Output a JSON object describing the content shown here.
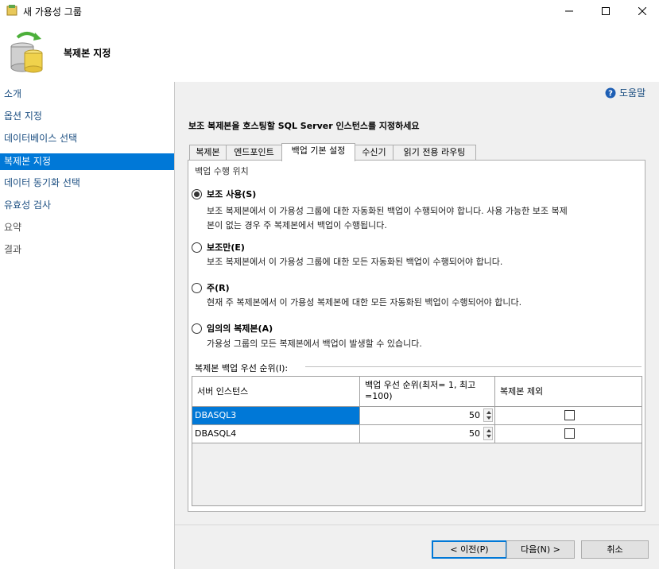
{
  "window": {
    "title": "새 가용성 그룹",
    "minimize_glyph": "—",
    "maximize_glyph": "☐",
    "close_glyph": "✕"
  },
  "header": {
    "title": "복제본 지정"
  },
  "nav": {
    "items": [
      {
        "label": "소개",
        "state": "link"
      },
      {
        "label": "옵션 지정",
        "state": "link"
      },
      {
        "label": "데이터베이스 선택",
        "state": "link"
      },
      {
        "label": "복제본 지정",
        "state": "active"
      },
      {
        "label": "데이터 동기화 선택",
        "state": "link"
      },
      {
        "label": "유효성 검사",
        "state": "link"
      },
      {
        "label": "요약",
        "state": "disabled"
      },
      {
        "label": "결과",
        "state": "disabled"
      }
    ]
  },
  "help": {
    "label": "도움말"
  },
  "main": {
    "instruction": "보조 복제본을 호스팅할 SQL Server 인스턴스를 지정하세요",
    "tabs": [
      {
        "label": "복제본"
      },
      {
        "label": "엔드포인트"
      },
      {
        "label": "백업 기본 설정",
        "active": true
      },
      {
        "label": "수신기"
      },
      {
        "label": "읽기 전용 라우팅"
      }
    ],
    "backup_location_label": "백업 수행 위치",
    "options": [
      {
        "label": "보조 사용(S)",
        "checked": true,
        "desc_lines": [
          "보조 복제본에서 이 가용성 그룹에 대한 자동화된 백업이 수행되어야 합니다. 사용 가능한 보조 복제",
          "본이 없는 경우 주 복제본에서 백업이 수행됩니다."
        ]
      },
      {
        "label": "보조만(E)",
        "checked": false,
        "desc_lines": [
          "보조 복제본에서 이 가용성 그룹에 대한 모든 자동화된 백업이 수행되어야 합니다."
        ]
      },
      {
        "label": "주(R)",
        "checked": false,
        "desc_lines": [
          "현재 주 복제본에서 이 가용성 복제본에 대한 모든 자동화된 백업이 수행되어야 합니다."
        ]
      },
      {
        "label": "임의의 복제본(A)",
        "checked": false,
        "desc_lines": [
          "가용성 그룹의 모든 복제본에서 백업이 발생할 수 있습니다."
        ]
      }
    ],
    "priority_section_label": "복제본 백업 우선 순위(I):",
    "grid": {
      "headers": [
        "서버 인스턴스",
        "백업 우선 순위(최저= 1, 최고=100)",
        "복제본 제외"
      ],
      "rows": [
        {
          "server": "DBASQL3",
          "priority": "50",
          "exclude": false,
          "selected": true
        },
        {
          "server": "DBASQL4",
          "priority": "50",
          "exclude": false,
          "selected": false
        }
      ]
    }
  },
  "buttons": {
    "prev": "< 이전(P)",
    "next": "다음(N) >",
    "cancel": "취소"
  },
  "colors": {
    "accent": "#0078d7",
    "link": "#1a4d80"
  }
}
